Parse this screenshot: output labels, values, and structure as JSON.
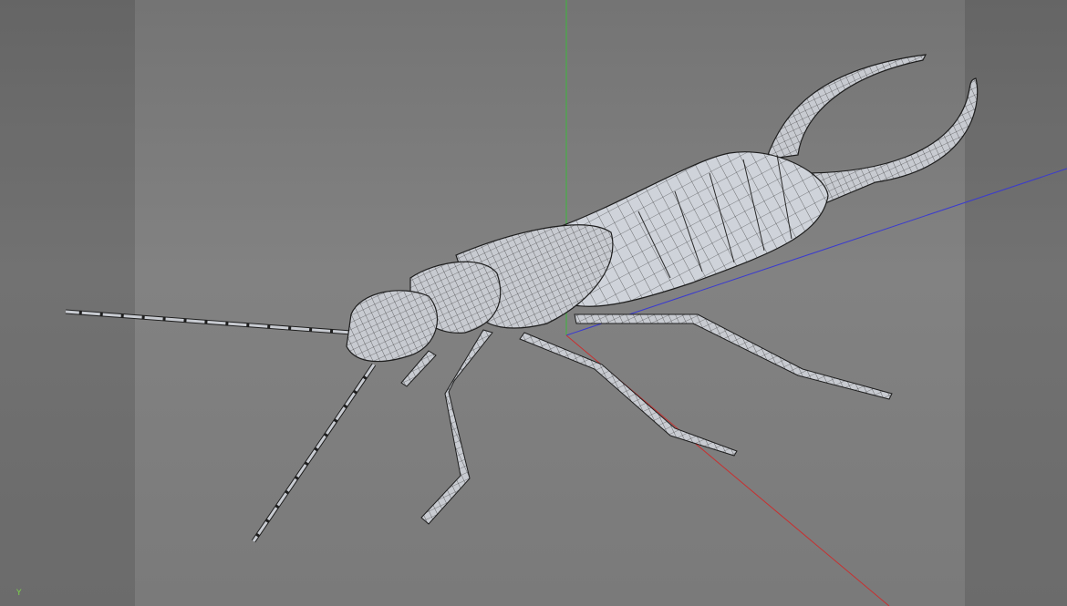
{
  "viewport": {
    "object": "earwig-wireframe-model",
    "axis_indicator": {
      "y_label": "Y"
    },
    "colors": {
      "x_axis": "#c83030",
      "y_axis": "#3cb83c",
      "z_axis": "#3a3ad0",
      "mesh_fill": "#c9ccd2",
      "wire": "#1e1e1e"
    }
  }
}
